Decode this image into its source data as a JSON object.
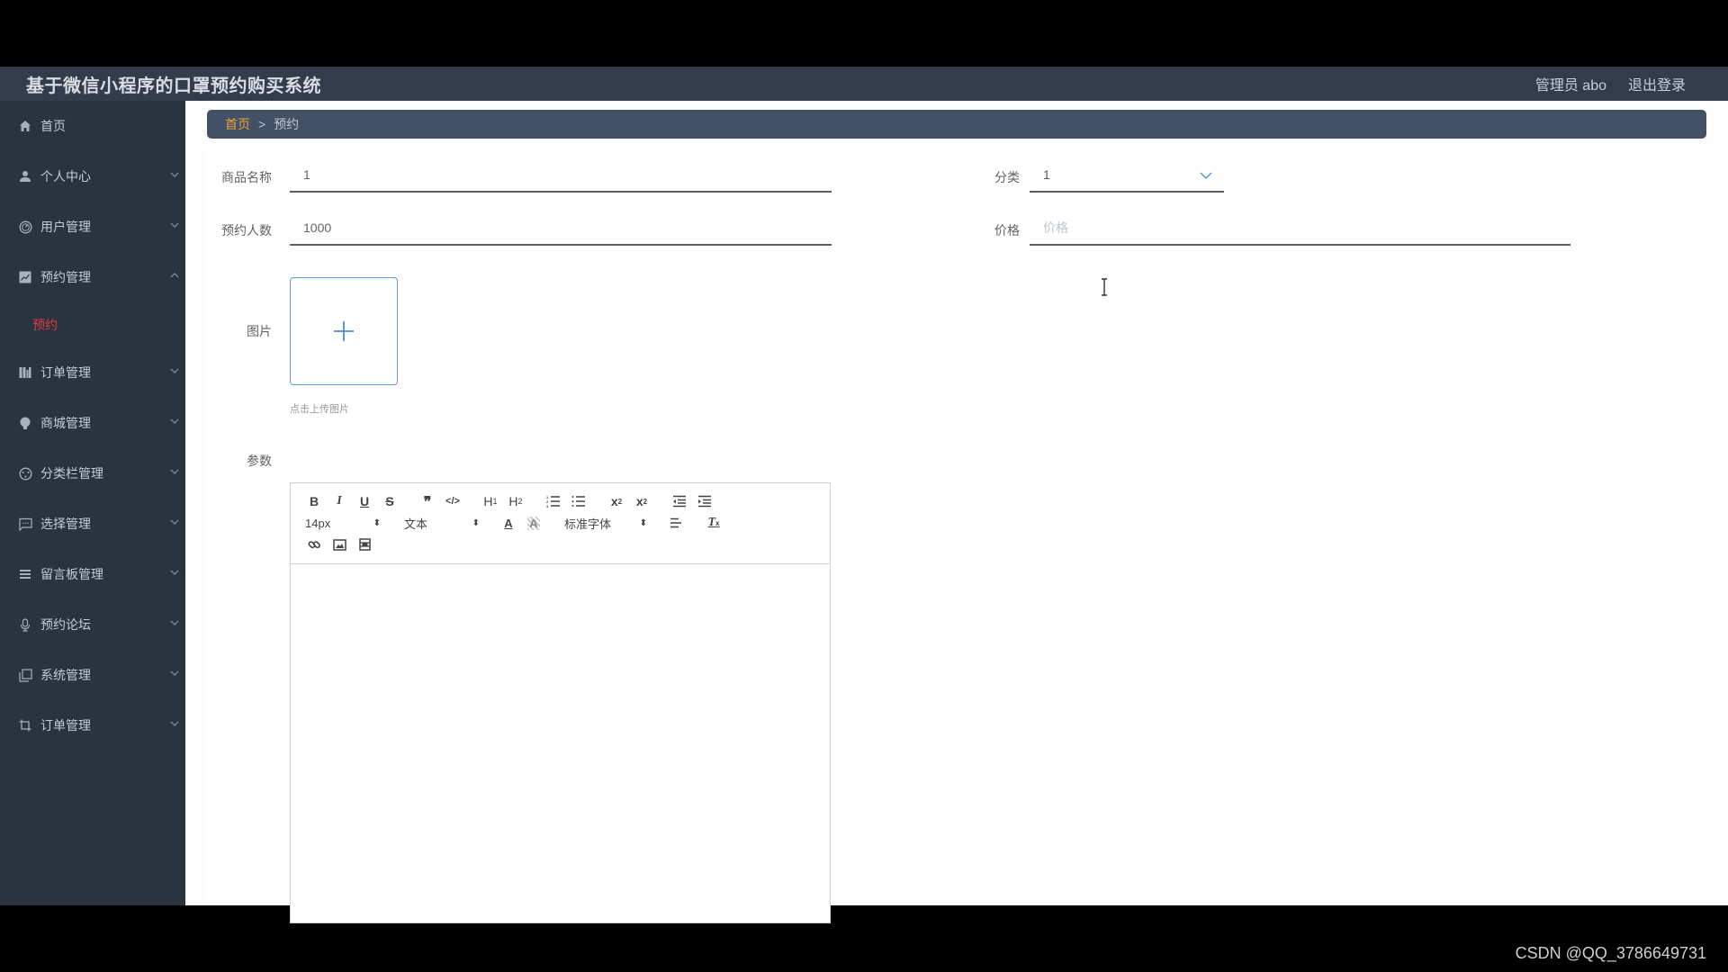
{
  "header": {
    "title": "基于微信小程序的口罩预约购买系统",
    "user_label": "管理员 abo",
    "logout_label": "退出登录"
  },
  "sidebar": {
    "items": [
      {
        "label": "首页",
        "icon": "home-icon",
        "expandable": false
      },
      {
        "label": "个人中心",
        "icon": "user-icon",
        "expandable": true,
        "expanded": false
      },
      {
        "label": "用户管理",
        "icon": "dashboard-icon",
        "expandable": true,
        "expanded": false
      },
      {
        "label": "预约管理",
        "icon": "chart-icon",
        "expandable": true,
        "expanded": true,
        "children": [
          {
            "label": "预约",
            "active": true
          }
        ]
      },
      {
        "label": "订单管理",
        "icon": "bars-icon",
        "expandable": true,
        "expanded": false
      },
      {
        "label": "商城管理",
        "icon": "bulb-icon",
        "expandable": true,
        "expanded": false
      },
      {
        "label": "分类栏管理",
        "icon": "compass-icon",
        "expandable": true,
        "expanded": false
      },
      {
        "label": "选择管理",
        "icon": "message-icon",
        "expandable": true,
        "expanded": false
      },
      {
        "label": "留言板管理",
        "icon": "list-icon",
        "expandable": true,
        "expanded": false
      },
      {
        "label": "预约论坛",
        "icon": "microphone-icon",
        "expandable": true,
        "expanded": false
      },
      {
        "label": "系统管理",
        "icon": "copy-icon",
        "expandable": true,
        "expanded": false
      },
      {
        "label": "订单管理",
        "icon": "crop-icon",
        "expandable": true,
        "expanded": false
      }
    ]
  },
  "breadcrumb": {
    "home": "首页",
    "separator": ">",
    "current": "预约"
  },
  "form": {
    "product_name": {
      "label": "商品名称",
      "value": "1"
    },
    "category": {
      "label": "分类",
      "value": "1"
    },
    "reservation_count": {
      "label": "预约人数",
      "value": "1000"
    },
    "price": {
      "label": "价格",
      "value": "",
      "placeholder": "价格"
    },
    "image": {
      "label": "图片",
      "tip": "点击上传图片"
    },
    "params": {
      "label": "参数"
    }
  },
  "editor": {
    "font_size": "14px",
    "header_select": "文本",
    "font_family": "标准字体",
    "buttons_row1": [
      "B",
      "I",
      "U",
      "S",
      "❞",
      "</>",
      "H1",
      "H2",
      "ol",
      "ul",
      "x₂",
      "x²",
      "outdent",
      "indent"
    ]
  },
  "watermark": "CSDN @QQ_3786649731",
  "colors": {
    "topbar": "#323c4a",
    "sidebar": "#2a3441",
    "breadcrumb_bg": "#435166",
    "breadcrumb_home": "#e6a23c",
    "active_menu": "#e23c3c",
    "upload_border": "#5d9be0"
  }
}
